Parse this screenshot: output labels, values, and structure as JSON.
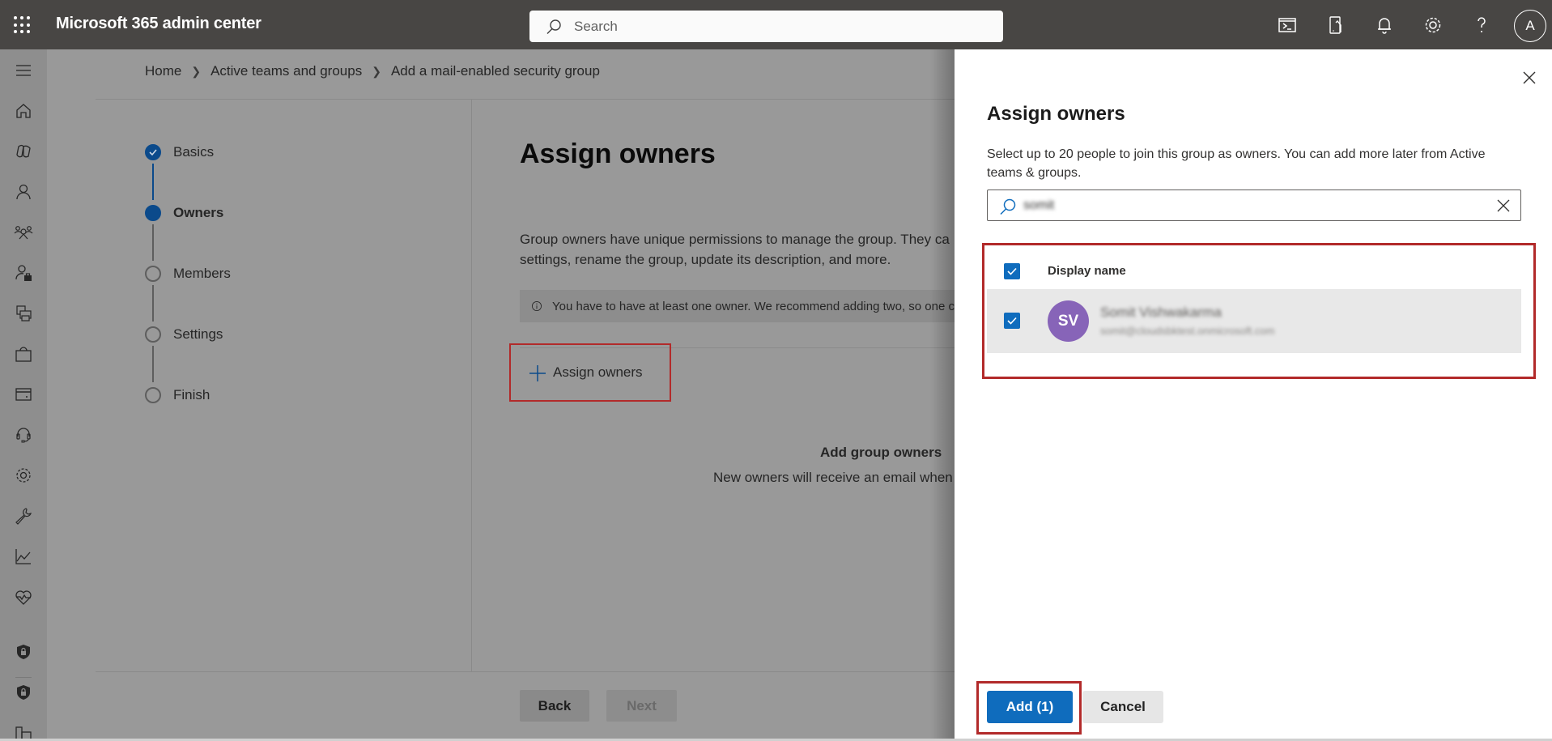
{
  "header": {
    "app_title": "Microsoft 365 admin center",
    "search_placeholder": "Search",
    "icons": [
      "app-launcher-icon",
      "cloud-shell-icon",
      "mobile-app-icon",
      "notifications-bell-icon",
      "settings-gear-icon",
      "help-question-icon"
    ],
    "avatar_initial": "A"
  },
  "sidebar": {
    "items": [
      {
        "icon": "hamburger-menu-icon"
      },
      {
        "icon": "home-icon"
      },
      {
        "icon": "copilot-icon"
      },
      {
        "icon": "users-icon"
      },
      {
        "icon": "teams-groups-icon"
      },
      {
        "icon": "roles-icon"
      },
      {
        "icon": "resources-printer-icon"
      },
      {
        "icon": "marketplace-bag-icon"
      },
      {
        "icon": "billing-card-icon"
      },
      {
        "icon": "support-headset-icon"
      },
      {
        "icon": "settings-gear-icon"
      },
      {
        "icon": "setup-wrench-icon"
      },
      {
        "icon": "reports-chart-icon"
      },
      {
        "icon": "health-heart-icon"
      },
      {
        "icon": "security-shield-icon"
      },
      {
        "icon": "compliance-shield-icon"
      },
      {
        "icon": "admin-centers-icon"
      }
    ]
  },
  "breadcrumb": {
    "items": [
      "Home",
      "Active teams and groups",
      "Add a mail-enabled security group"
    ]
  },
  "wizard": {
    "steps": [
      {
        "label": "Basics",
        "state": "done"
      },
      {
        "label": "Owners",
        "state": "current"
      },
      {
        "label": "Members",
        "state": "pending"
      },
      {
        "label": "Settings",
        "state": "pending"
      },
      {
        "label": "Finish",
        "state": "pending"
      }
    ],
    "title": "Assign owners",
    "description_line1": "Group owners have unique permissions to manage the group. They ca",
    "description_line2": "settings, rename the group, update its description, and more.",
    "info_text": "You have to have at least one owner. We recommend adding two, so one c",
    "assign_button": "Assign owners",
    "empty_title": "Add group owners",
    "empty_desc": "New owners will receive an email when",
    "back_label": "Back",
    "next_label": "Next"
  },
  "panel": {
    "title": "Assign owners",
    "description": "Select up to 20 people to join this group as owners. You can add more later from Active teams & groups.",
    "search_value": "somit",
    "column_header": "Display name",
    "header_checked": true,
    "rows": [
      {
        "initials": "SV",
        "name": "Somit Vishwakarma",
        "email": "somit@cloudsbktest.onmicrosoft.com",
        "checked": true,
        "avatar_color": "#8764b8"
      }
    ],
    "add_label": "Add (1)",
    "cancel_label": "Cancel"
  },
  "colors": {
    "accent": "#0f6cbd",
    "highlight_box": "#b22a2a",
    "step_active": "#0b4a8b"
  }
}
